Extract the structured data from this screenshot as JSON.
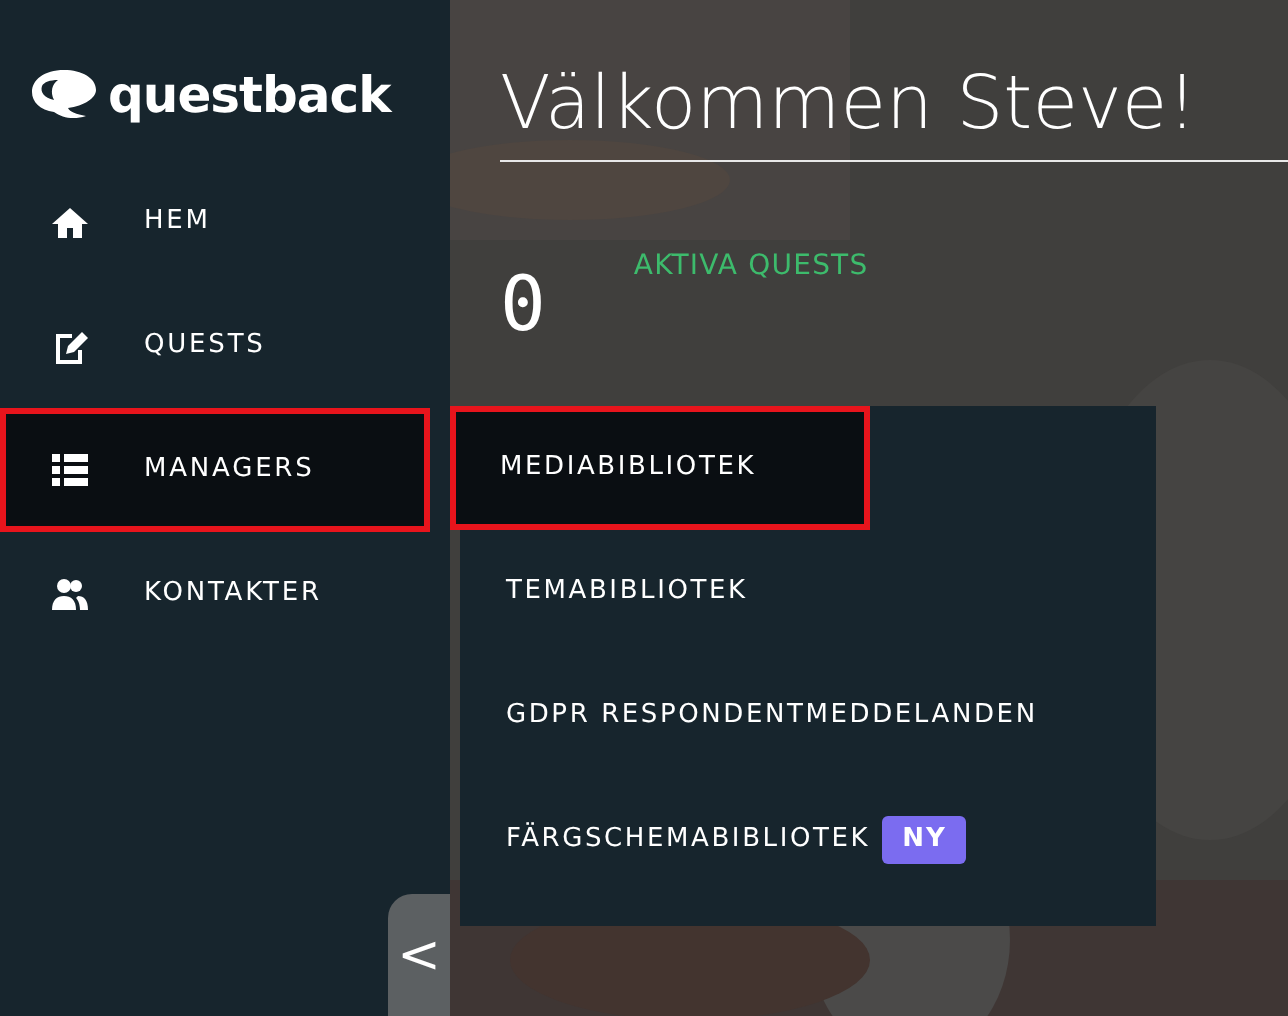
{
  "sidebar": {
    "logo": "questback",
    "items": [
      {
        "label": "HEM",
        "selected": false,
        "highlighted": false
      },
      {
        "label": "QUESTS",
        "selected": false,
        "highlighted": false
      },
      {
        "label": "MANAGERS",
        "selected": true,
        "highlighted": true
      },
      {
        "label": "KONTAKTER",
        "selected": false,
        "highlighted": false
      }
    ],
    "collapse_button": "<"
  },
  "main": {
    "title": "Välkommen Steve!",
    "stat": {
      "value": "0",
      "label": "AKTIVA QUESTS"
    }
  },
  "managers_menu": [
    {
      "label": "MEDIABIBLIOTEK",
      "selected": true,
      "highlighted": true
    },
    {
      "label": "TEMABIBLIOTEK",
      "selected": false,
      "highlighted": false
    },
    {
      "label": "GDPR RESPONDENTMEDDELANDEN",
      "selected": false,
      "highlighted": false
    },
    {
      "label": "FÄRGSCHEMABIBLIOTEK",
      "badge": "NY",
      "selected": false,
      "highlighted": false
    }
  ]
}
